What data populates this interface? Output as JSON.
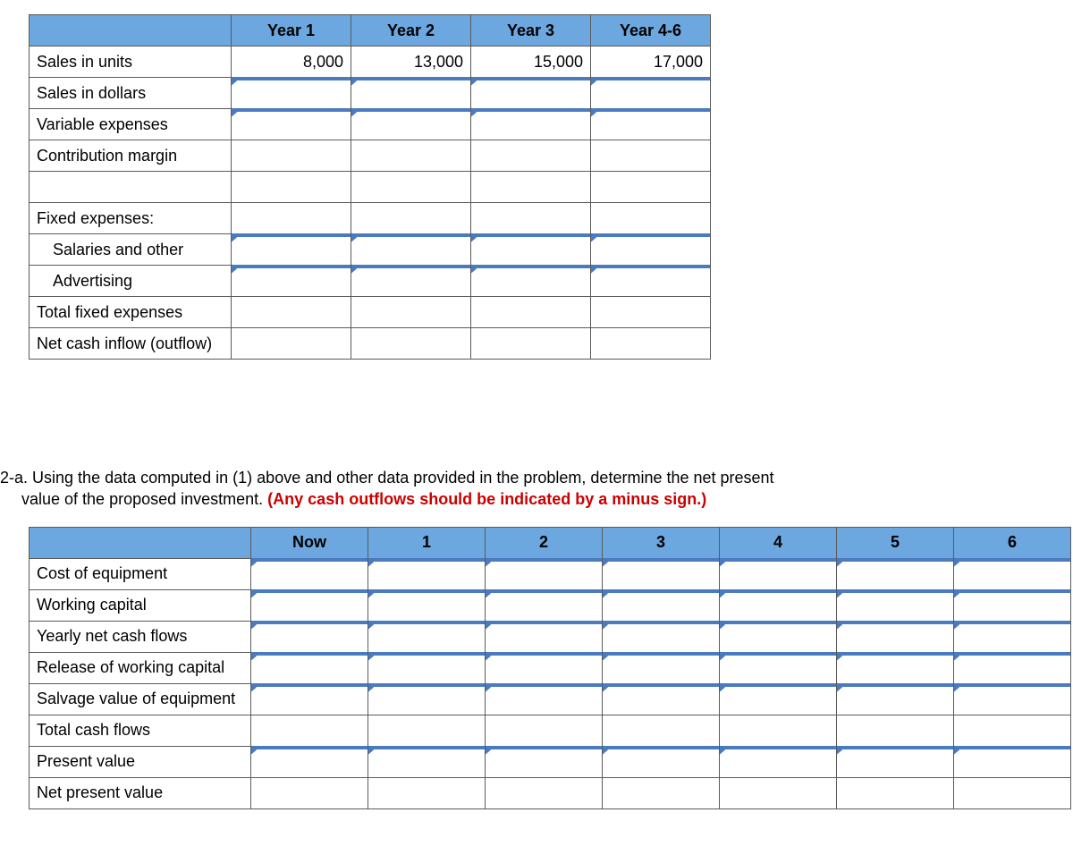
{
  "table1": {
    "headers": [
      "Year 1",
      "Year 2",
      "Year 3",
      "Year 4-6"
    ],
    "rows": [
      {
        "label": "Sales in units",
        "values": [
          "8,000",
          "13,000",
          "15,000",
          "17,000"
        ],
        "flags": false,
        "indent": false
      },
      {
        "label": "Sales in dollars",
        "values": [
          "",
          "",
          "",
          ""
        ],
        "flags": true,
        "indent": false
      },
      {
        "label": "Variable expenses",
        "values": [
          "",
          "",
          "",
          ""
        ],
        "flags": true,
        "indent": false
      },
      {
        "label": "Contribution margin",
        "values": [
          "",
          "",
          "",
          ""
        ],
        "flags": false,
        "indent": false
      },
      {
        "label": "",
        "values": [
          "",
          "",
          "",
          ""
        ],
        "flags": false,
        "indent": false,
        "empty": true
      },
      {
        "label": "Fixed expenses:",
        "values": [
          "",
          "",
          "",
          ""
        ],
        "flags": false,
        "indent": false
      },
      {
        "label": "Salaries and other",
        "values": [
          "",
          "",
          "",
          ""
        ],
        "flags": true,
        "indent": true
      },
      {
        "label": "Advertising",
        "values": [
          "",
          "",
          "",
          ""
        ],
        "flags": true,
        "indent": true
      },
      {
        "label": "Total fixed expenses",
        "values": [
          "",
          "",
          "",
          ""
        ],
        "flags": false,
        "indent": false
      },
      {
        "label": "Net cash inflow  (outflow)",
        "values": [
          "",
          "",
          "",
          ""
        ],
        "flags": false,
        "indent": false
      }
    ]
  },
  "question": {
    "prefix": "2-a. ",
    "line1": "Using the data computed in (1) above and other data provided in the problem, determine the net present",
    "line2_plain": "value of the proposed investment. ",
    "line2_red": "(Any cash outflows should be indicated by a minus sign.)"
  },
  "table2": {
    "headers": [
      "Now",
      "1",
      "2",
      "3",
      "4",
      "5",
      "6"
    ],
    "rows": [
      {
        "label": "Cost of equipment",
        "flags": true
      },
      {
        "label": "Working capital",
        "flags": true
      },
      {
        "label": "Yearly net cash flows",
        "flags": true
      },
      {
        "label": "Release of working capital",
        "flags": true
      },
      {
        "label": "Salvage value of equipment",
        "flags": true
      },
      {
        "label": "Total cash flows",
        "flags": false
      },
      {
        "label": "Present value",
        "flags": true
      },
      {
        "label": "Net present value",
        "flags": false
      }
    ]
  }
}
